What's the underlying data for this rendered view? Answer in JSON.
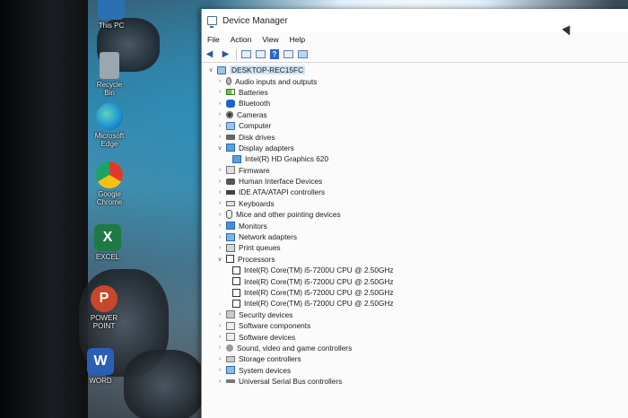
{
  "desktop": {
    "icons": [
      {
        "label": "This PC",
        "icon": "computer-icon",
        "color": "#2d6fb3"
      },
      {
        "label": "Recycle Bin",
        "icon": "recycle-bin-icon",
        "color": "#9aa6b0"
      },
      {
        "label": "Microsoft Edge",
        "icon": "edge-icon",
        "color": "#1b8fcf"
      },
      {
        "label": "Google Chrome",
        "icon": "chrome-icon",
        "color": "#dd3b2f"
      },
      {
        "label": "EXCEL",
        "icon": "excel-icon",
        "glyph": "X",
        "color": "#1e7a45"
      },
      {
        "label": "POWER POINT",
        "icon": "powerpoint-icon",
        "glyph": "P",
        "color": "#c8462b"
      },
      {
        "label": "WORD",
        "icon": "word-icon",
        "glyph": "W",
        "color": "#2b5fb5"
      }
    ]
  },
  "window": {
    "title": "Device Manager",
    "menu": [
      "File",
      "Action",
      "View",
      "Help"
    ],
    "toolbar": [
      "back-arrow-icon",
      "forward-arrow-icon",
      "properties-icon",
      "show-hide-icon",
      "help-icon",
      "update-icon",
      "computer-scan-icon"
    ]
  },
  "tree": {
    "root": "DESKTOP-REC15FC",
    "categories": [
      {
        "label": "Audio inputs and outputs",
        "icon": "audio-icon",
        "expanded": false
      },
      {
        "label": "Batteries",
        "icon": "battery-icon",
        "expanded": false
      },
      {
        "label": "Bluetooth",
        "icon": "bluetooth-icon",
        "expanded": false
      },
      {
        "label": "Cameras",
        "icon": "camera-icon",
        "expanded": false
      },
      {
        "label": "Computer",
        "icon": "computer-icon",
        "expanded": false
      },
      {
        "label": "Disk drives",
        "icon": "disk-drive-icon",
        "expanded": false
      },
      {
        "label": "Display adapters",
        "icon": "display-adapter-icon",
        "expanded": true,
        "children": [
          "Intel(R) HD Graphics 620"
        ]
      },
      {
        "label": "Firmware",
        "icon": "firmware-icon",
        "expanded": false
      },
      {
        "label": "Human Interface Devices",
        "icon": "hid-icon",
        "expanded": false
      },
      {
        "label": "IDE ATA/ATAPI controllers",
        "icon": "ide-controller-icon",
        "expanded": false
      },
      {
        "label": "Keyboards",
        "icon": "keyboard-icon",
        "expanded": false
      },
      {
        "label": "Mice and other pointing devices",
        "icon": "mouse-icon",
        "expanded": false
      },
      {
        "label": "Monitors",
        "icon": "monitor-icon",
        "expanded": false
      },
      {
        "label": "Network adapters",
        "icon": "network-adapter-icon",
        "expanded": false
      },
      {
        "label": "Print queues",
        "icon": "printer-icon",
        "expanded": false
      },
      {
        "label": "Processors",
        "icon": "processor-icon",
        "expanded": true,
        "children": [
          "Intel(R) Core(TM) i5-7200U CPU @ 2.50GHz",
          "Intel(R) Core(TM) i5-7200U CPU @ 2.50GHz",
          "Intel(R) Core(TM) i5-7200U CPU @ 2.50GHz",
          "Intel(R) Core(TM) i5-7200U CPU @ 2.50GHz"
        ]
      },
      {
        "label": "Security devices",
        "icon": "security-device-icon",
        "expanded": false
      },
      {
        "label": "Software components",
        "icon": "software-component-icon",
        "expanded": false
      },
      {
        "label": "Software devices",
        "icon": "software-device-icon",
        "expanded": false
      },
      {
        "label": "Sound, video and game controllers",
        "icon": "sound-icon",
        "expanded": false
      },
      {
        "label": "Storage controllers",
        "icon": "storage-controller-icon",
        "expanded": false
      },
      {
        "label": "System devices",
        "icon": "system-device-icon",
        "expanded": false
      },
      {
        "label": "Universal Serial Bus controllers",
        "icon": "usb-icon",
        "expanded": false
      }
    ]
  }
}
